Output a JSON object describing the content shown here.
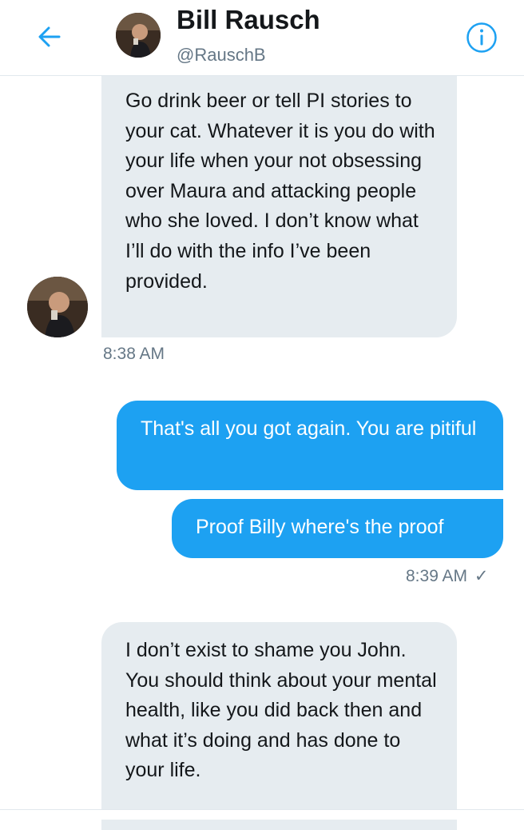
{
  "header": {
    "name": "Bill Rausch",
    "handle": "@RauschB"
  },
  "messages": [
    {
      "direction": "incoming",
      "text": "Go drink beer or tell PI stories to your cat. Whatever it is you do with your life when your not obsessing over Maura and attacking people who she loved. I don’t know what I’ll do with the info I’ve been provided.",
      "time": "8:38 AM"
    },
    {
      "direction": "outgoing",
      "text": "That's all you got again. You are pitiful"
    },
    {
      "direction": "outgoing",
      "text": "Proof Billy where's the proof",
      "time": "8:39 AM",
      "status": "✓"
    },
    {
      "direction": "incoming",
      "text": "I don’t exist to shame you John. You should think about your mental health, like you did back then and what it’s doing and has done to your life."
    }
  ],
  "colors": {
    "accent": "#1da1f2",
    "incoming_bubble": "#e6ecf0",
    "text": "#14171a",
    "secondary_text": "#657786"
  },
  "icons": {
    "back": "arrow-left-icon",
    "info": "info-circle-icon"
  }
}
